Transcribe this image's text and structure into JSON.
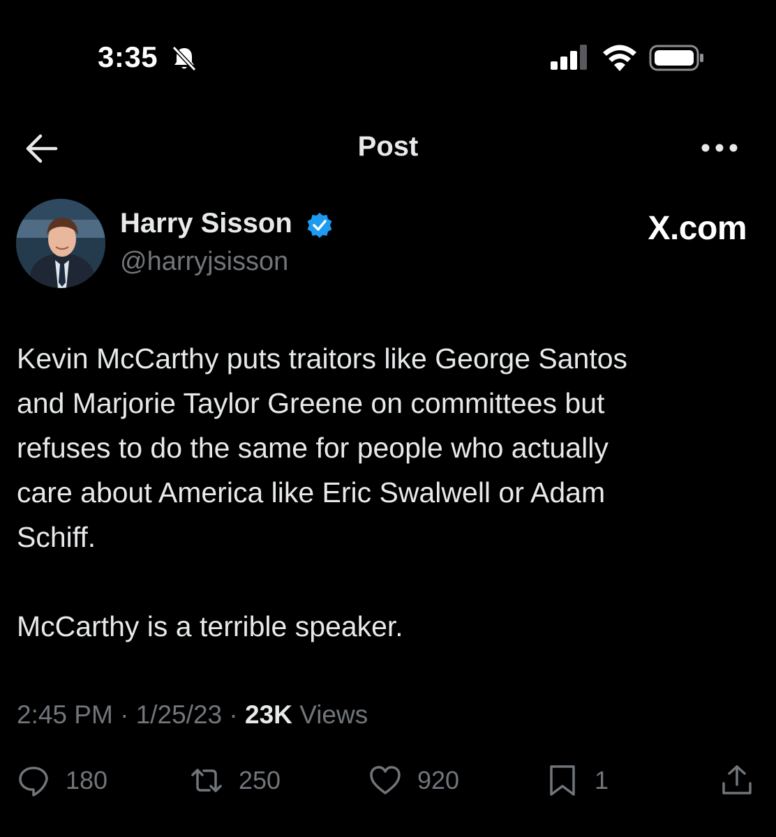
{
  "status_bar": {
    "time": "3:35",
    "icons": [
      "bell-slash-icon",
      "cellular-signal-icon",
      "wifi-icon",
      "battery-icon"
    ]
  },
  "header": {
    "title": "Post",
    "back_icon": "arrow-left-icon",
    "more_icon": "ellipsis-icon"
  },
  "post": {
    "author": {
      "name": "Harry Sisson",
      "handle": "@harryjsisson",
      "verified": true
    },
    "source_label": "X.com",
    "body": "Kevin McCarthy puts traitors like George Santos\nand Marjorie Taylor Greene on committees but\nrefuses to do the same for people who actually\ncare about America like Eric Swalwell or Adam\nSchiff.\n\nMcCarthy is a terrible speaker.",
    "time": "2:45 PM",
    "date": "1/25/23",
    "separator": "·",
    "views_count": "23K",
    "views_label": "Views"
  },
  "actions": {
    "replies": "180",
    "reposts": "250",
    "likes": "920",
    "bookmarks": "1"
  },
  "colors": {
    "background": "#000000",
    "text": "#e7e9ea",
    "secondary": "#71767b",
    "verified_badge": "#1d9bf0"
  }
}
